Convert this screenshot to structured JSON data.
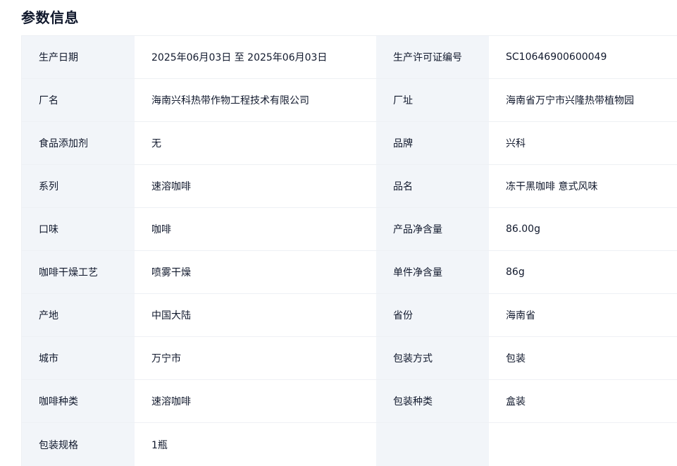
{
  "section": {
    "title": "参数信息"
  },
  "rows": [
    {
      "l1": "生产日期",
      "v1": "2025年06月03日 至 2025年06月03日",
      "l2": "生产许可证编号",
      "v2": "SC10646900600049"
    },
    {
      "l1": "厂名",
      "v1": "海南兴科热带作物工程技术有限公司",
      "l2": "厂址",
      "v2": "海南省万宁市兴隆热带植物园"
    },
    {
      "l1": "食品添加剂",
      "v1": "无",
      "l2": "品牌",
      "v2": "兴科"
    },
    {
      "l1": "系列",
      "v1": "速溶咖啡",
      "l2": "品名",
      "v2": "冻干黑咖啡 意式风味"
    },
    {
      "l1": "口味",
      "v1": "咖啡",
      "l2": "产品净含量",
      "v2": "86.00g"
    },
    {
      "l1": "咖啡干燥工艺",
      "v1": "喷雾干燥",
      "l2": "单件净含量",
      "v2": "86g"
    },
    {
      "l1": "产地",
      "v1": "中国大陆",
      "l2": "省份",
      "v2": "海南省"
    },
    {
      "l1": "城市",
      "v1": "万宁市",
      "l2": "包装方式",
      "v2": "包装"
    },
    {
      "l1": "咖啡种类",
      "v1": "速溶咖啡",
      "l2": "包装种类",
      "v2": "盒装"
    },
    {
      "l1": "包装规格",
      "v1": "1瓶",
      "l2": "",
      "v2": ""
    }
  ]
}
